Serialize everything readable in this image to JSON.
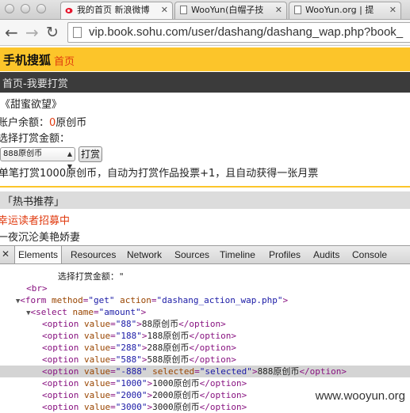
{
  "browser": {
    "tabs": [
      {
        "title": "我的首页 新浪微博",
        "icon": "weibo-icon"
      },
      {
        "title": "WooYun(白帽子技",
        "icon": "page-icon"
      },
      {
        "title": "WooYun.org | 提",
        "icon": "page-icon"
      }
    ],
    "url": "vip.book.sohu.com/user/dashang/dashang_wap.php?book_"
  },
  "page": {
    "brand": "手机搜狐",
    "home_link": "首页",
    "breadcrumb": "首页-我要打赏",
    "book_title": "《甜蜜欲望》",
    "balance_label": "账户余额：",
    "balance_value": "0",
    "balance_unit": "原创币",
    "choose_label": "选择打赏金额：",
    "selected_amount": "888原创币",
    "tip_button": "打赏",
    "info": "单笔打赏1000原创币，自动为打赏作品投票+1，且自动获得一张月票",
    "rec_heading": "「热书推荐」",
    "rec_items": [
      "幸运读者招募中",
      "一夜沉沦美艳娇妻"
    ]
  },
  "devtools": {
    "tabs": [
      "Elements",
      "Resources",
      "Network",
      "Sources",
      "Timeline",
      "Profiles",
      "Audits",
      "Console"
    ],
    "active_tab": "Elements",
    "code": {
      "text_node": "选择打赏金额：\"",
      "br_tag": "<br>",
      "form_tag": "form",
      "form_method_attr": "method",
      "form_method_val": "\"get\"",
      "form_action_attr": "action",
      "form_action_val": "\"dashang_action_wap.php\"",
      "select_tag": "select",
      "select_name_attr": "name",
      "select_name_val": "\"amount\"",
      "options": [
        {
          "value": "\"88\"",
          "text": "88原创币"
        },
        {
          "value": "\"188\"",
          "text": "188原创币"
        },
        {
          "value": "\"288\"",
          "text": "288原创币"
        },
        {
          "value": "\"588\"",
          "text": "588原创币"
        },
        {
          "value": "\"-888\"",
          "text": "888原创币",
          "selected": "\"selected\""
        },
        {
          "value": "\"1000\"",
          "text": "1000原创币"
        },
        {
          "value": "\"2000\"",
          "text": "2000原创币"
        },
        {
          "value": "\"3000\"",
          "text": "3000原创币"
        }
      ]
    }
  },
  "watermark": "www.wooyun.org"
}
